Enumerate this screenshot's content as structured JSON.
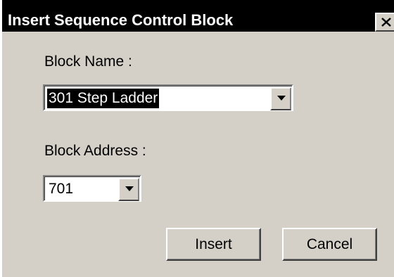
{
  "dialog": {
    "title": "Insert Sequence Control Block",
    "close_icon": "close-icon"
  },
  "block_name": {
    "label": "Block Name :",
    "value": "301  Step Ladder",
    "dropdown_icon": "chevron-down-icon"
  },
  "block_address": {
    "label": "Block Address :",
    "value": "701",
    "dropdown_icon": "chevron-down-icon"
  },
  "buttons": {
    "insert": "Insert",
    "cancel": "Cancel"
  },
  "colors": {
    "face": "#d4d0c8",
    "titlebar": "#000000",
    "selection": "#000000"
  }
}
